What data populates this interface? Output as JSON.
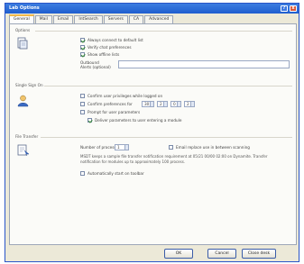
{
  "window": {
    "title": "Lab Options",
    "help_label": "?",
    "close_label": "x"
  },
  "tabs": [
    {
      "label": "General"
    },
    {
      "label": "Mail"
    },
    {
      "label": "Email"
    },
    {
      "label": "IntSearch"
    },
    {
      "label": "Servers"
    },
    {
      "label": "CA"
    },
    {
      "label": "Advanced"
    }
  ],
  "general": {
    "section_label": "Options",
    "icon": "document-icon",
    "options": [
      {
        "label": "Always connect to default list",
        "checked": true
      },
      {
        "label": "Verify chat preferences",
        "checked": true
      },
      {
        "label": "Show offline lists",
        "checked": true
      }
    ],
    "field_label_1": "Outbound",
    "field_label_2": "Alerts (optional)"
  },
  "single_sign_on": {
    "section_label": "Single Sign On",
    "icon": "user-icon",
    "options": [
      {
        "label": "Confirm user privileges while logged on",
        "checked": false
      },
      {
        "label": "Confirm preferences for",
        "checked": false
      },
      {
        "label": "Prompt for user parameters",
        "checked": false
      }
    ],
    "spin_values": [
      "30",
      "2",
      "0",
      "2"
    ],
    "sub_option": {
      "label": "Deliver parameters to user entering a module",
      "checked": true
    }
  },
  "file_transfer": {
    "section_label": "File Transfer",
    "icon": "transfer-icon",
    "count_label": "Number of process",
    "count_value": "1",
    "right_option": {
      "label": "Email replace use in between scanning",
      "checked": false
    },
    "note": "MSDT keeps a sample file transfer notification requirement at 05/21 00/00 02:00 on Dynamite. Transfer notification for modules up to approximately 100 process.",
    "bottom_option": {
      "label": "Automatically start on toolbar",
      "checked": false
    }
  },
  "buttons": {
    "ok": "OK",
    "cancel": "Cancel",
    "close": "Close desk"
  }
}
